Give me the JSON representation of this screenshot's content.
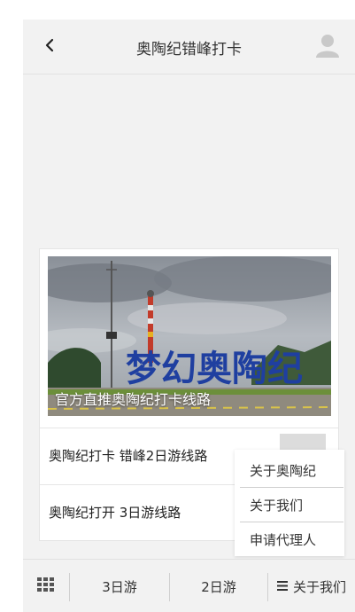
{
  "header": {
    "title": "奥陶纪错峰打卡",
    "back_icon": "chevron-left-icon",
    "avatar_icon": "user-avatar-icon"
  },
  "card": {
    "banner_caption": "官方直推奥陶纪打卡线路",
    "banner_sign_text": "梦幻奥陶纪",
    "routes": [
      {
        "label": "奥陶纪打卡 错峰2日游线路"
      },
      {
        "label": "奥陶纪打开 3日游线路"
      }
    ]
  },
  "dropdown": {
    "items": [
      {
        "label": "关于奥陶纪"
      },
      {
        "label": "关于我们"
      },
      {
        "label": "申请代理人"
      }
    ]
  },
  "tabbar": {
    "grid_icon": "grid-icon",
    "tab_3day": "3日游",
    "tab_2day": "2日游",
    "tab_about": "关于我们",
    "menu_icon": "menu-icon"
  },
  "colors": {
    "background": "#f2f2f2",
    "sign_blue": "#1f3fa0"
  }
}
